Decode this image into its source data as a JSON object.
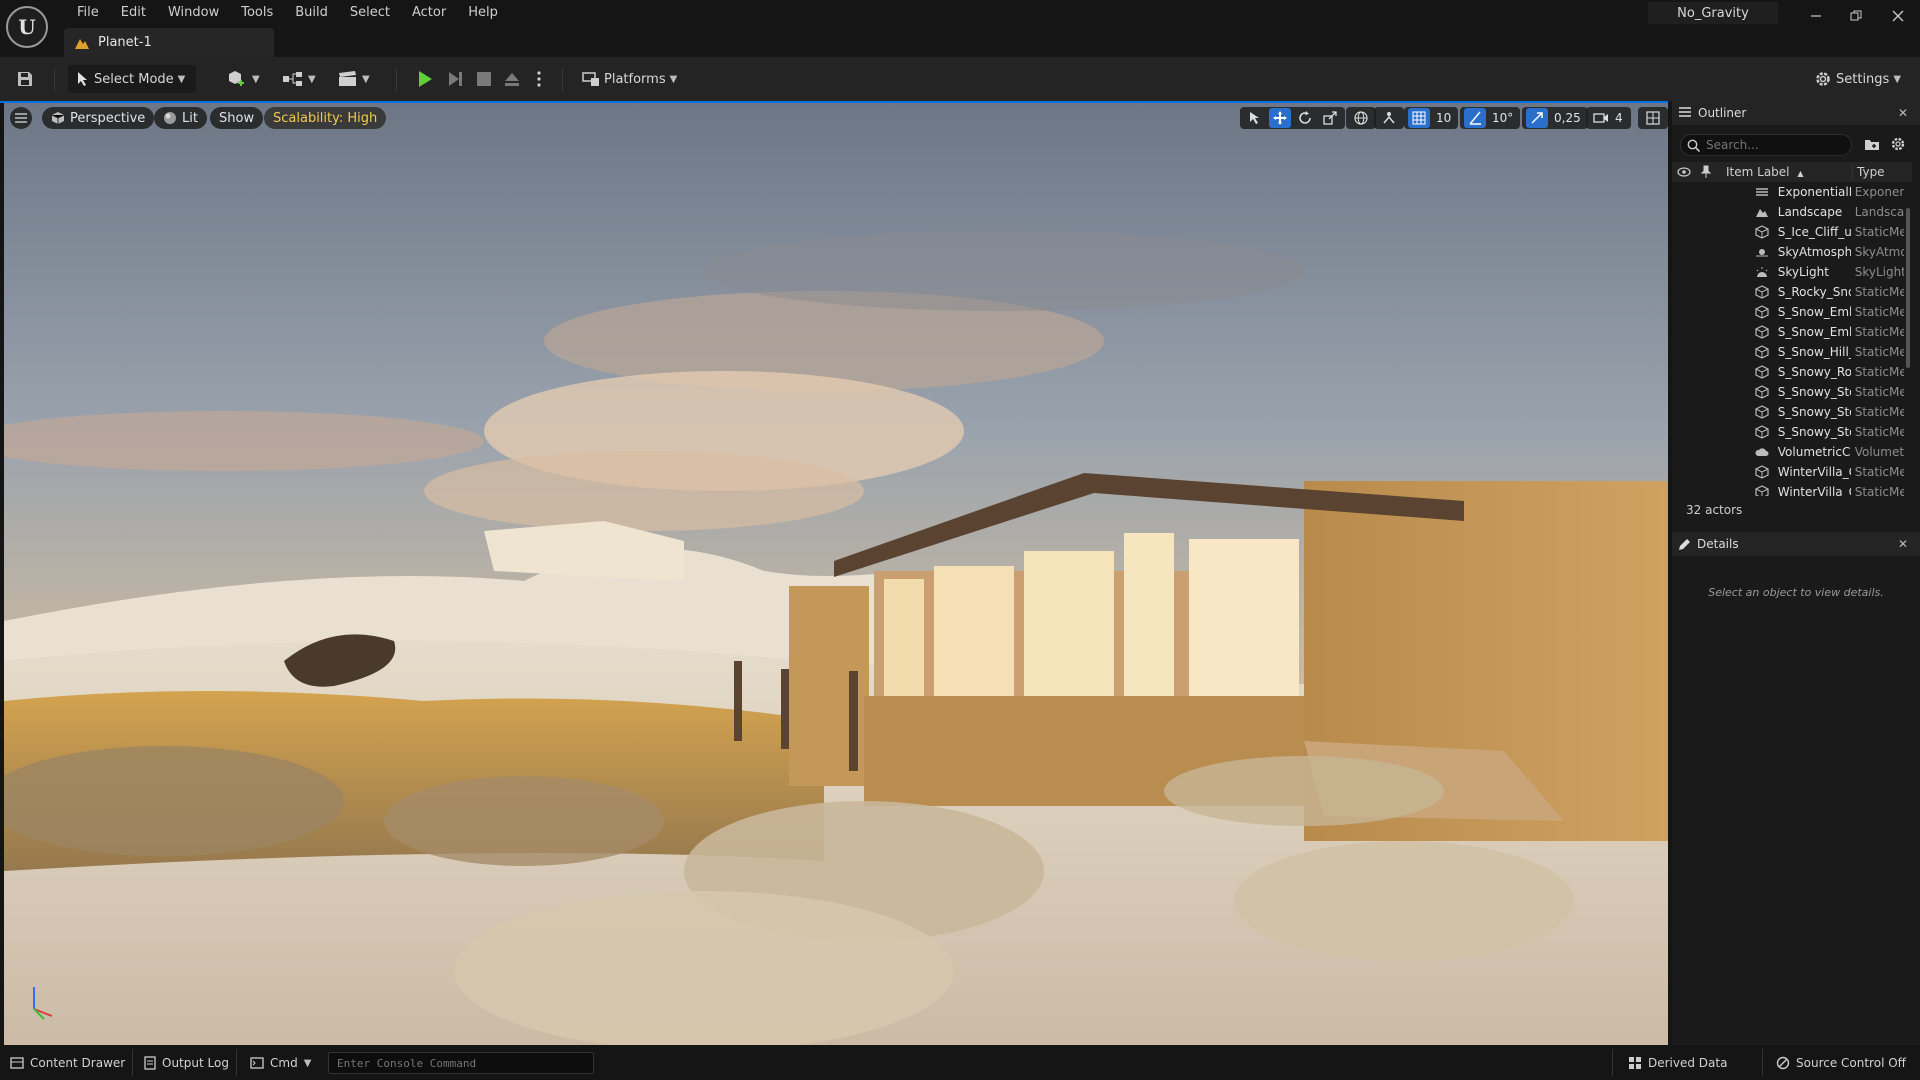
{
  "menu": [
    "File",
    "Edit",
    "Window",
    "Tools",
    "Build",
    "Select",
    "Actor",
    "Help"
  ],
  "document_tab": "Planet-1",
  "project_name": "No_Gravity",
  "toolbar": {
    "select_mode": "Select Mode",
    "platforms": "Platforms",
    "settings": "Settings"
  },
  "viewport": {
    "perspective": "Perspective",
    "lit": "Lit",
    "show": "Show",
    "scalability": "Scalability: High",
    "grid_snap": "10",
    "rotation_snap": "10°",
    "scale_snap": "0,25",
    "camera_speed": "4"
  },
  "outliner": {
    "title": "Outliner",
    "search_placeholder": "Search...",
    "col_label": "Item Label",
    "col_type": "Type",
    "rows": [
      {
        "label": "ExponentialHeightFog",
        "type": "ExponentialHeightFog",
        "icon": "fog-icon"
      },
      {
        "label": "Landscape",
        "type": "Landscape",
        "icon": "landscape-icon"
      },
      {
        "label": "S_Ice_Cliff_u",
        "type": "StaticMeshActor",
        "icon": "static-mesh-icon"
      },
      {
        "label": "SkyAtmosphere",
        "type": "SkyAtmosphere",
        "icon": "sky-atmosphere-icon"
      },
      {
        "label": "SkyLight",
        "type": "SkyLight",
        "icon": "skylight-icon"
      },
      {
        "label": "S_Rocky_Snow",
        "type": "StaticMeshActor",
        "icon": "static-mesh-icon"
      },
      {
        "label": "S_Snow_Embankment",
        "type": "StaticMeshActor",
        "icon": "static-mesh-icon"
      },
      {
        "label": "S_Snow_Embankment",
        "type": "StaticMeshActor",
        "icon": "static-mesh-icon"
      },
      {
        "label": "S_Snow_Hill_",
        "type": "StaticMeshActor",
        "icon": "static-mesh-icon"
      },
      {
        "label": "S_Snowy_Rock",
        "type": "StaticMeshActor",
        "icon": "static-mesh-icon"
      },
      {
        "label": "S_Snowy_Stone",
        "type": "StaticMeshActor",
        "icon": "static-mesh-icon"
      },
      {
        "label": "S_Snowy_Stone",
        "type": "StaticMeshActor",
        "icon": "static-mesh-icon"
      },
      {
        "label": "S_Snowy_Stone",
        "type": "StaticMeshActor",
        "icon": "static-mesh-icon"
      },
      {
        "label": "VolumetricCloud",
        "type": "VolumetricCloud",
        "icon": "cloud-icon"
      },
      {
        "label": "WinterVilla_C",
        "type": "StaticMeshActor",
        "icon": "static-mesh-icon"
      },
      {
        "label": "WinterVilla_C",
        "type": "StaticMeshActor",
        "icon": "static-mesh-icon"
      }
    ],
    "actor_count": "32 actors"
  },
  "details": {
    "title": "Details",
    "empty_message": "Select an object to view details."
  },
  "statusbar": {
    "content_drawer": "Content Drawer",
    "output_log": "Output Log",
    "cmd": "Cmd",
    "console_placeholder": "Enter Console Command",
    "derived_data": "Derived Data",
    "source_control": "Source Control Off"
  },
  "colors": {
    "accent_blue": "#2b6fcc",
    "play_green": "#5fcf3a",
    "scalability_yellow": "#f2c94c",
    "panel_bg": "#1a1a1a"
  }
}
